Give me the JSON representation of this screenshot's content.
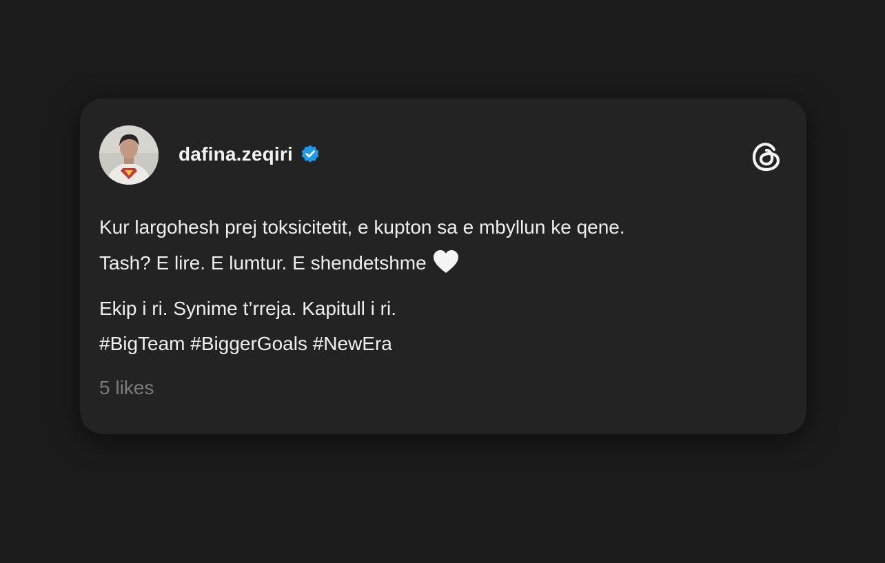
{
  "post": {
    "author": {
      "username": "dafina.zeqiri",
      "verified": true,
      "avatar": "profile-photo"
    },
    "platform_icon": "threads-logo-icon",
    "body": {
      "line1": "Kur largohesh prej toksicitetit, e kupton sa e mbyllun ke qene.",
      "line2": "Tash? E lire. E lumtur. E shendetshme",
      "line2_emoji": "white-heart-icon",
      "line3": "Ekip i ri. Synime t’rreja. Kapitull i ri.",
      "line4": "#BigTeam #BiggerGoals #NewEra"
    },
    "likes": "5 likes"
  },
  "colors": {
    "background": "#1b1b1b",
    "card": "#232323",
    "text": "#efefef",
    "muted": "#7c7c7c",
    "verified_badge": "#1d9bf0"
  }
}
